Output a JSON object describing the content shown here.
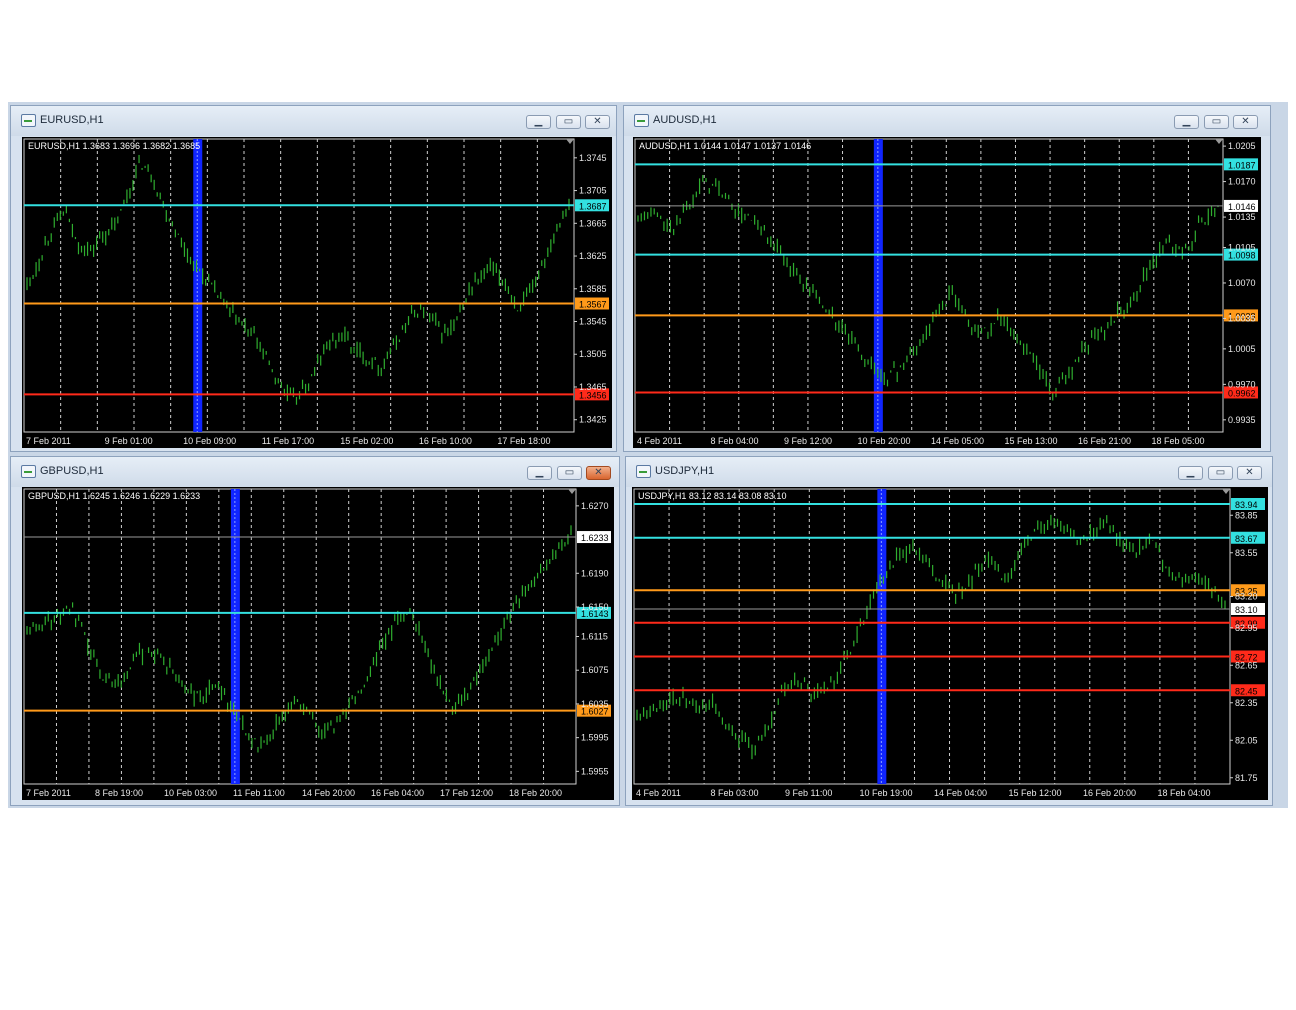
{
  "windows": [
    {
      "id": "eurusd",
      "title": "EURUSD,H1",
      "ohlc_label": "EURUSD,H1  1.3683 1.3696 1.3682 1.3685",
      "close_active": false,
      "chart_data": {
        "type": "bar",
        "symbol": "EURUSD",
        "timeframe": "H1",
        "ohlc": {
          "open": 1.3683,
          "high": 1.3696,
          "low": 1.3682,
          "close": 1.3685
        },
        "ylim": [
          1.341,
          1.3768
        ],
        "y_ticks": [
          "1.3745",
          "1.3705",
          "1.3665",
          "1.3625",
          "1.3585",
          "1.3545",
          "1.3505",
          "1.3465",
          "1.3425"
        ],
        "x_ticks": [
          "7 Feb 2011",
          "9 Feb 01:00",
          "10 Feb 09:00",
          "11 Feb 17:00",
          "15 Feb 02:00",
          "16 Feb 10:00",
          "17 Feb 18:00"
        ],
        "hlines": [
          {
            "value": 1.3687,
            "label": "1.3687",
            "color": "#33e0e0"
          },
          {
            "value": 1.3567,
            "label": "1.3567",
            "color": "#ff9a1a"
          },
          {
            "value": 1.3456,
            "label": "1.3456",
            "color": "#ff2a1a"
          }
        ],
        "current_price": null,
        "highlight_x": 0.315,
        "series": [
          1.359,
          1.362,
          1.366,
          1.368,
          1.364,
          1.363,
          1.365,
          1.366,
          1.37,
          1.374,
          1.372,
          1.368,
          1.365,
          1.362,
          1.36,
          1.358,
          1.356,
          1.354,
          1.353,
          1.35,
          1.347,
          1.345,
          1.346,
          1.349,
          1.352,
          1.353,
          1.351,
          1.35,
          1.349,
          1.351,
          1.354,
          1.356,
          1.355,
          1.353,
          1.354,
          1.358,
          1.36,
          1.361,
          1.359,
          1.356,
          1.358,
          1.362,
          1.366,
          1.369
        ]
      }
    },
    {
      "id": "audusd",
      "title": "AUDUSD,H1",
      "ohlc_label": "AUDUSD,H1  1.0144 1.0147 1.0137 1.0146",
      "close_active": false,
      "chart_data": {
        "type": "bar",
        "symbol": "AUDUSD",
        "timeframe": "H1",
        "ohlc": {
          "open": 1.0144,
          "high": 1.0147,
          "low": 1.0137,
          "close": 1.0146
        },
        "ylim": [
          0.9923,
          1.0212
        ],
        "y_ticks": [
          "1.0205",
          "1.0170",
          "1.0135",
          "1.0105",
          "1.0070",
          "1.0035",
          "1.0005",
          "0.9970",
          "0.9935"
        ],
        "x_ticks": [
          "4 Feb 2011",
          "8 Feb 04:00",
          "9 Feb 12:00",
          "10 Feb 20:00",
          "14 Feb 05:00",
          "15 Feb 13:00",
          "16 Feb 21:00",
          "18 Feb 05:00"
        ],
        "hlines": [
          {
            "value": 1.0187,
            "label": "1.0187",
            "color": "#33e0e0"
          },
          {
            "value": 1.0098,
            "label": "1.0098",
            "color": "#33e0e0"
          },
          {
            "value": 1.0038,
            "label": "1.0038",
            "color": "#ff9a1a"
          },
          {
            "value": 0.9962,
            "label": "0.9962",
            "color": "#ff2a1a"
          }
        ],
        "current_price": {
          "value": 1.0146,
          "label": "1.0146"
        },
        "highlight_x": 0.413,
        "series": [
          1.013,
          1.014,
          1.012,
          1.015,
          1.017,
          1.016,
          1.014,
          1.013,
          1.011,
          1.009,
          1.007,
          1.005,
          1.003,
          1.001,
          0.999,
          0.9975,
          0.999,
          1.001,
          1.004,
          1.006,
          1.003,
          1.002,
          1.004,
          1.001,
          0.999,
          0.996,
          0.998,
          1.001,
          1.002,
          1.004,
          1.006,
          1.009,
          1.011,
          1.01,
          1.013,
          1.0146
        ]
      }
    },
    {
      "id": "gbpusd",
      "title": "GBPUSD,H1",
      "ohlc_label": "GBPUSD,H1  1.6245 1.6246 1.6229 1.6233",
      "close_active": true,
      "chart_data": {
        "type": "bar",
        "symbol": "GBPUSD",
        "timeframe": "H1",
        "ohlc": {
          "open": 1.6245,
          "high": 1.6246,
          "low": 1.6229,
          "close": 1.6233
        },
        "ylim": [
          1.594,
          1.629
        ],
        "y_ticks": [
          "1.6270",
          "1.6190",
          "1.6150",
          "1.6115",
          "1.6075",
          "1.6035",
          "1.5995",
          "1.5955"
        ],
        "x_ticks": [
          "7 Feb 2011",
          "8 Feb 19:00",
          "10 Feb 03:00",
          "11 Feb 11:00",
          "14 Feb 20:00",
          "16 Feb 04:00",
          "17 Feb 12:00",
          "18 Feb 20:00"
        ],
        "hlines": [
          {
            "value": 1.6143,
            "label": "1.6143",
            "color": "#33e0e0"
          },
          {
            "value": 1.6027,
            "label": "1.6027",
            "color": "#ff9a1a"
          }
        ],
        "current_price": {
          "value": 1.6233,
          "label": "1.6233"
        },
        "highlight_x": 0.382,
        "series": [
          1.612,
          1.613,
          1.614,
          1.615,
          1.611,
          1.607,
          1.606,
          1.608,
          1.61,
          1.609,
          1.607,
          1.605,
          1.604,
          1.606,
          1.603,
          1.6,
          1.598,
          1.601,
          1.604,
          1.603,
          1.6,
          1.601,
          1.604,
          1.606,
          1.61,
          1.613,
          1.615,
          1.611,
          1.606,
          1.603,
          1.605,
          1.608,
          1.611,
          1.615,
          1.617,
          1.619,
          1.621,
          1.624
        ]
      }
    },
    {
      "id": "usdjpy",
      "title": "USDJPY,H1",
      "ohlc_label": "USDJPY,H1  83.12 83.14 83.08 83.10",
      "close_active": false,
      "chart_data": {
        "type": "bar",
        "symbol": "USDJPY",
        "timeframe": "H1",
        "ohlc": {
          "open": 83.12,
          "high": 83.14,
          "low": 83.08,
          "close": 83.1
        },
        "ylim": [
          81.7,
          84.06
        ],
        "y_ticks": [
          "83.85",
          "83.55",
          "83.20",
          "82.95",
          "82.65",
          "82.35",
          "82.05",
          "81.75"
        ],
        "x_ticks": [
          "4 Feb 2011",
          "8 Feb 03:00",
          "9 Feb 11:00",
          "10 Feb 19:00",
          "14 Feb 04:00",
          "15 Feb 12:00",
          "16 Feb 20:00",
          "18 Feb 04:00"
        ],
        "hlines": [
          {
            "value": 83.94,
            "label": "83.94",
            "color": "#33e0e0"
          },
          {
            "value": 83.67,
            "label": "83.67",
            "color": "#33e0e0"
          },
          {
            "value": 83.25,
            "label": "83.25",
            "color": "#ff9a1a"
          },
          {
            "value": 82.99,
            "label": "82.99",
            "color": "#ff2a1a"
          },
          {
            "value": 82.72,
            "label": "82.72",
            "color": "#ff2a1a"
          },
          {
            "value": 82.45,
            "label": "82.45",
            "color": "#ff2a1a"
          }
        ],
        "current_price": {
          "value": 83.1,
          "label": "83.10"
        },
        "highlight_x": 0.415,
        "series": [
          82.25,
          82.3,
          82.35,
          82.4,
          82.3,
          82.35,
          82.2,
          82.05,
          81.95,
          82.2,
          82.45,
          82.55,
          82.4,
          82.5,
          82.65,
          82.9,
          83.2,
          83.4,
          83.55,
          83.6,
          83.4,
          83.3,
          83.2,
          83.4,
          83.5,
          83.35,
          83.55,
          83.7,
          83.8,
          83.75,
          83.65,
          83.7,
          83.85,
          83.6,
          83.55,
          83.65,
          83.4,
          83.3,
          83.35,
          83.25,
          83.15
        ]
      }
    }
  ]
}
